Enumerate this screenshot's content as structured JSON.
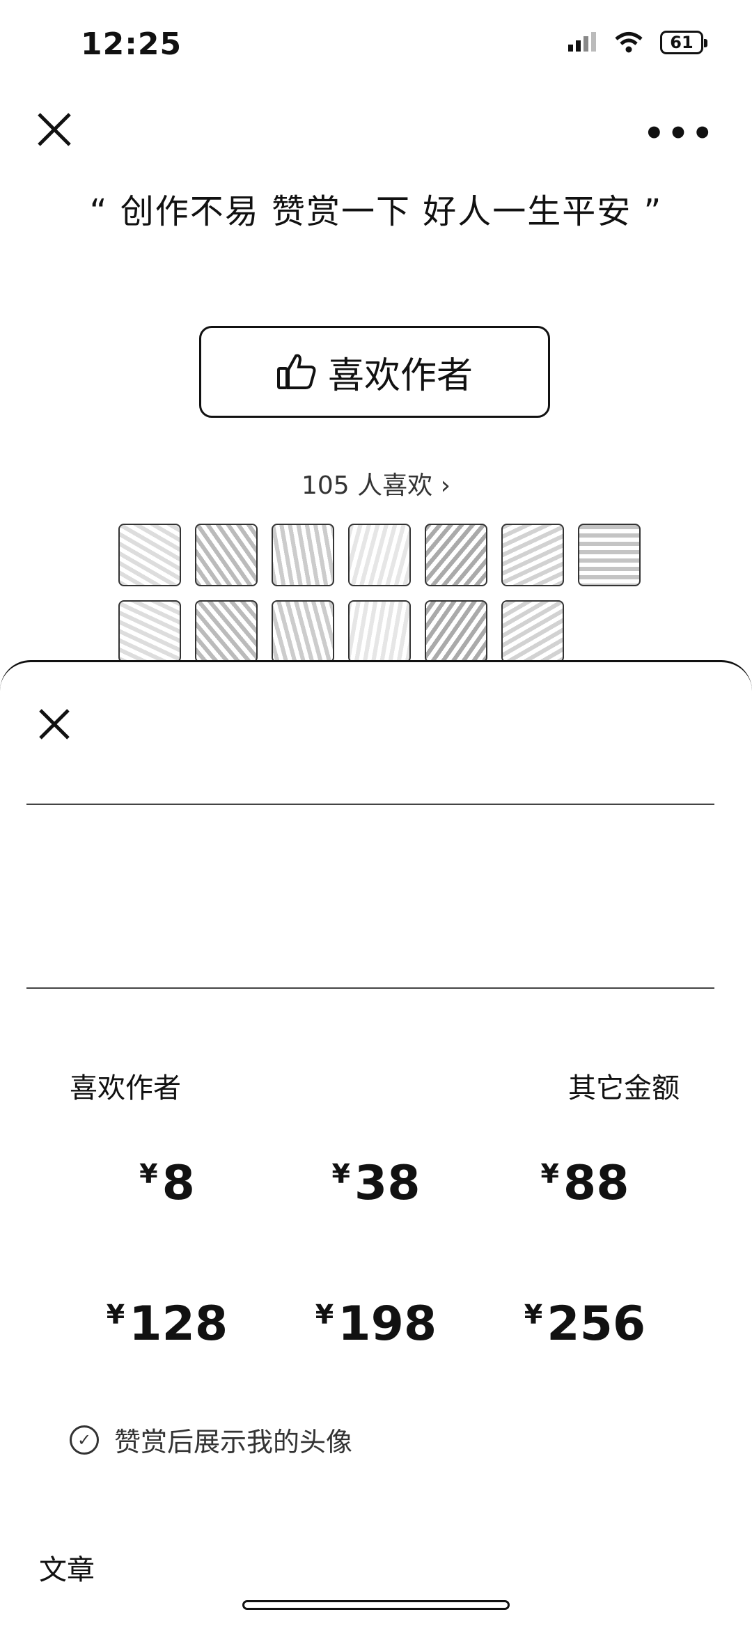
{
  "status_bar": {
    "time": "12:25",
    "battery": "61"
  },
  "header": {
    "quote": "“ 创作不易 赞赏一下 好人一生平安 ”",
    "like_button": "喜欢作者",
    "likes_count": "105 人喜欢 ›"
  },
  "avatars": [
    "avatar-1",
    "avatar-2",
    "avatar-3",
    "avatar-4",
    "avatar-5",
    "avatar-6",
    "avatar-7",
    "avatar-8",
    "avatar-9",
    "avatar-10",
    "avatar-11",
    "avatar-12",
    "avatar-13"
  ],
  "sheet": {
    "section_title": "喜欢作者",
    "other_amount": "其它金额",
    "currency": "¥",
    "amounts": [
      "8",
      "38",
      "88",
      "128",
      "198",
      "256"
    ],
    "show_avatar_label": "赞赏后展示我的头像",
    "article_label": "文章"
  },
  "colors": {
    "text": "#111111",
    "background": "#ffffff",
    "border": "#111111"
  },
  "icons": [
    "close-icon",
    "more-icon",
    "thumbs-up-icon",
    "chevron-right-icon",
    "checkmark-icon",
    "signal-icon",
    "wifi-icon",
    "battery-icon"
  ]
}
